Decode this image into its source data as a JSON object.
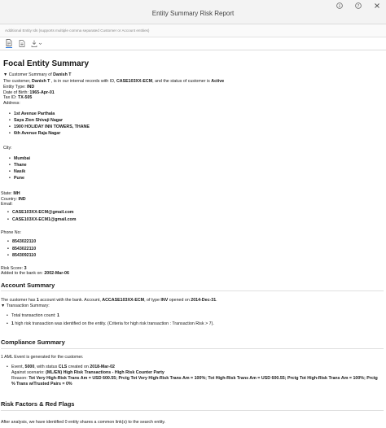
{
  "window": {
    "title": "Entity Summary Risk Report"
  },
  "filter": {
    "placeholder": "Additional Entity Ids (supports multiple comma separated Customer or Account entities)"
  },
  "report": {
    "title": "Focal Entity Summary",
    "customer_summary_label": "▼ Customer Summary of ",
    "customer_name": "Danish T",
    "intro": {
      "p1": "The customer, ",
      "name": "Danish T",
      "p2": " , is in our internal records with ID, ",
      "id": "CASE103XX-ECM",
      "p3": ", and the status of customer is ",
      "status": "Active"
    },
    "entity_type": {
      "label": "Entity Type: ",
      "value": "IND"
    },
    "dob": {
      "label": "Date of Birth: ",
      "value": "1965-Apr-01"
    },
    "tax_id": {
      "label": "Tax ID: ",
      "value": "TX-505"
    },
    "address_label": "Address:",
    "addresses": [
      "1st Avenue Parthala",
      "Saya Zion Shivaji Nagar",
      "1900 HOLIDAY INN TOWERS, THANE",
      "6th Avenue Raja Nagar"
    ],
    "city_label": "City:",
    "cities": [
      "Mumbai",
      "Thane",
      "Nasik",
      "Pune"
    ],
    "state": {
      "label": "State: ",
      "value": "MH"
    },
    "country": {
      "label": "Country: ",
      "value": "IND"
    },
    "email_label": "Email:",
    "emails": [
      "CASE103XX-ECM@gmail.com",
      "CASE103XX-ECM1@gmail.com"
    ],
    "phone_label": "Phone No:",
    "phones": [
      "8543022110",
      "8543022110",
      "8543092110"
    ],
    "risk_score": {
      "label": "Risk Score: ",
      "value": "3"
    },
    "added": {
      "label": "Added to the bank on: ",
      "value": "2002-Mar-06"
    },
    "account_summary": {
      "heading": "Account Summary",
      "p1": "The customer has ",
      "count": "1",
      "p2": " account with the bank. Account, ",
      "account": "ACCASE103XX-ECM",
      "p3": ", of type ",
      "type": "INV",
      "p4": " opened on ",
      "opened": "2014-Dec-31",
      "p5": ".",
      "txn_summary_label": "▼ Transaction Summary:",
      "total_label": "Total transaction count: ",
      "total_value": "1",
      "high_risk_count": "1",
      "high_risk_text": " high risk transaction was identified on the entity. (Criteria for high risk transaction : Transaction Risk > 7)."
    },
    "compliance_summary": {
      "heading": "Compliance Summary",
      "aml_count": "1",
      "aml_text": " AML Event is generated for the customer.",
      "event_p1": "Event, ",
      "event_id": "5000",
      "event_p2": ", with status ",
      "event_status": "CLS",
      "event_p3": " created on ",
      "event_date": "2018-Mar-02",
      "against_label": "Against scenario: ",
      "scenario": "(ML/EN) High Risk Transactions - High Risk Counter Party",
      "reason_label": "Reason: ",
      "reason_line1": "Tot Very High-Risk Trans Am = USD 600.55; Prctg Tot Very High-Risk Trans Am = 100%; Tot High-Risk Trans Am = USD 600.55; Prctg Tot High-Risk Trans Am = 100%; Prctg",
      "reason_line2": "% Trans w/Trusted Pairs = 0%"
    },
    "risk_factors": {
      "heading": "Risk Factors & Red Flags",
      "text": "After analysis, we have identified 0 entity shares a common link(s) to the search entity."
    }
  }
}
